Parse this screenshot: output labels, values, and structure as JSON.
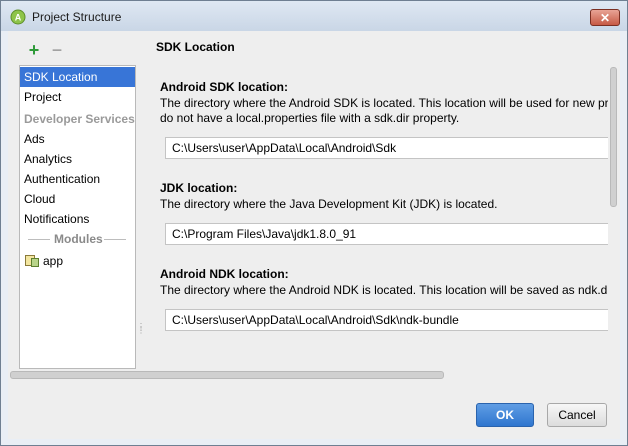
{
  "window": {
    "title": "Project Structure",
    "close_glyph": "✕",
    "app_icon": "android-studio-icon"
  },
  "toolbar": {
    "add_glyph": "+",
    "remove_glyph": "−"
  },
  "sidebar": {
    "items_top": [
      {
        "label": "SDK Location",
        "selected": true
      },
      {
        "label": "Project"
      }
    ],
    "developer_services_header": "Developer Services",
    "developer_services": [
      {
        "label": "Ads"
      },
      {
        "label": "Analytics"
      },
      {
        "label": "Authentication"
      },
      {
        "label": "Cloud"
      },
      {
        "label": "Notifications"
      }
    ],
    "modules_header": "Modules",
    "modules": [
      {
        "label": "app",
        "icon": "module-folder-icon"
      }
    ]
  },
  "main": {
    "heading": "SDK Location",
    "sections": [
      {
        "title": "Android SDK location:",
        "description": [
          "The directory where the Android SDK is located. This location will be used for new projects and existing projects that",
          "do not have a local.properties file with a sdk.dir property."
        ],
        "path": "C:\\Users\\user\\AppData\\Local\\Android\\Sdk"
      },
      {
        "title": "JDK location:",
        "description": [
          "The directory where the Java Development Kit (JDK) is located."
        ],
        "path": "C:\\Program Files\\Java\\jdk1.8.0_91"
      },
      {
        "title": "Android NDK location:",
        "description": [
          "The directory where the Android NDK is located. This location will be saved as ndk.dir property"
        ],
        "path": "C:\\Users\\user\\AppData\\Local\\Android\\Sdk\\ndk-bundle"
      }
    ]
  },
  "buttons": {
    "ok": "OK",
    "cancel": "Cancel"
  },
  "colors": {
    "accent": "#3875d7",
    "add": "#2e9a38",
    "ok_button": "#2f76cf"
  }
}
